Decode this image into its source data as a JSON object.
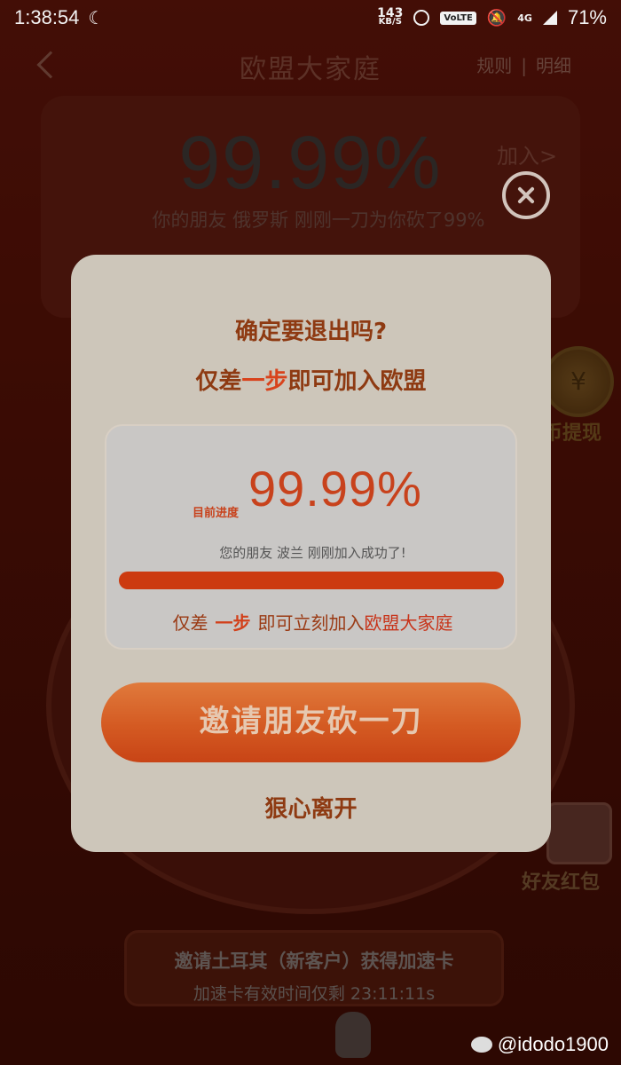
{
  "statusbar": {
    "time": "1:38:54",
    "net_speed_value": "143",
    "net_speed_unit": "KB/S",
    "volte": "VoLTE",
    "network": "4G",
    "battery": "71%"
  },
  "navbar": {
    "title": "欧盟大家庭",
    "rules": "规则",
    "separator": "|",
    "details": "明细"
  },
  "background": {
    "percent": "99.99%",
    "join": "加入>",
    "subtitle": "你的朋友 俄罗斯 刚刚一刀为你砍了99%",
    "coin_symbol": "¥",
    "coin_label": "币提现",
    "redpack_label": "好友红包",
    "banner_title": "邀请土耳其（新客户）获得加速卡",
    "banner_sub": "加速卡有效时间仅剩 23:11:11s"
  },
  "modal": {
    "question": "确定要退出吗?",
    "sub_prefix": "仅差",
    "sub_highlight": "一步",
    "sub_suffix": "即可加入欧盟",
    "progress": {
      "label": "目前进度",
      "value": "99.99%",
      "fraction": 0.9999,
      "note": "您的朋友  波兰  刚刚加入成功了!",
      "bottom_prefix": "仅差",
      "bottom_strong": "一步",
      "bottom_mid": "即可立刻加入",
      "bottom_red": "欧盟大家庭"
    },
    "invite_button": "邀请朋友砍一刀",
    "leave_button": "狠心离开"
  },
  "watermark": "@idodo1900",
  "colors": {
    "accent": "#c8421c",
    "modal_bg": "#cdc6ba",
    "button": "#d45a22"
  }
}
